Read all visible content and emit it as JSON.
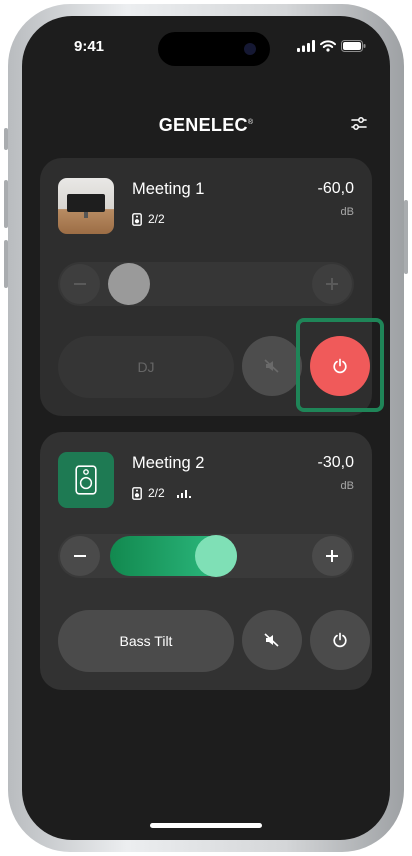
{
  "status_bar": {
    "time": "9:41"
  },
  "header": {
    "brand": "GENELEC",
    "brand_mark": "®"
  },
  "colors": {
    "accent_green": "#22a36c",
    "power_red": "#f05a5a",
    "card_bg": "#2e2e2e",
    "screen_bg": "#1d1d1d"
  },
  "rooms": [
    {
      "name": "Meeting 1",
      "speakers": "2/2",
      "level": "-60,0",
      "unit": "dB",
      "mode_label": "DJ",
      "power": "on",
      "icons": {
        "thumbnail": "room-photo",
        "speaker": "speaker-icon",
        "mute": "mute-icon",
        "power": "power-icon"
      }
    },
    {
      "name": "Meeting 2",
      "speakers": "2/2",
      "level": "-30,0",
      "unit": "dB",
      "mode_label": "Bass Tilt",
      "volume_fill": 0.52,
      "icons": {
        "thumbnail": "speaker-icon",
        "signal": "signal-bars-icon",
        "mute": "mute-icon",
        "power": "power-icon"
      }
    }
  ]
}
